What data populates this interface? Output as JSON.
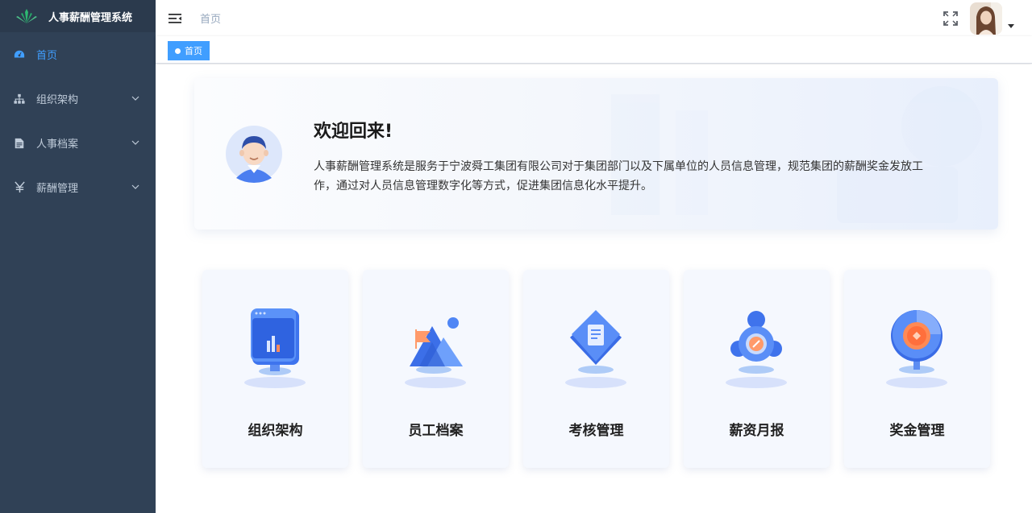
{
  "app": {
    "title": "人事薪酬管理系统"
  },
  "sidebar": {
    "items": [
      {
        "label": "首页",
        "icon": "dashboard-icon",
        "active": true
      },
      {
        "label": "组织架构",
        "icon": "org-tree-icon"
      },
      {
        "label": "人事档案",
        "icon": "document-icon"
      },
      {
        "label": "薪酬管理",
        "icon": "yen-icon"
      }
    ]
  },
  "header": {
    "breadcrumb": "首页"
  },
  "tags": {
    "active_tag": "首页"
  },
  "welcome": {
    "title": "欢迎回来!",
    "description": "人事薪酬管理系统是服务于宁波舜工集团有限公司对于集团部门以及下属单位的人员信息管理，规范集团的薪酬奖金发放工作，通过对人员信息管理数字化等方式，促进集团信息化水平提升。"
  },
  "cards": [
    {
      "label": "组织架构",
      "icon": "org-chart-icon"
    },
    {
      "label": "员工档案",
      "icon": "employee-file-icon"
    },
    {
      "label": "考核管理",
      "icon": "assessment-icon"
    },
    {
      "label": "薪资月报",
      "icon": "salary-report-icon"
    },
    {
      "label": "奖金管理",
      "icon": "bonus-icon"
    }
  ],
  "colors": {
    "sidebar_bg": "#304156",
    "accent": "#409eff"
  }
}
